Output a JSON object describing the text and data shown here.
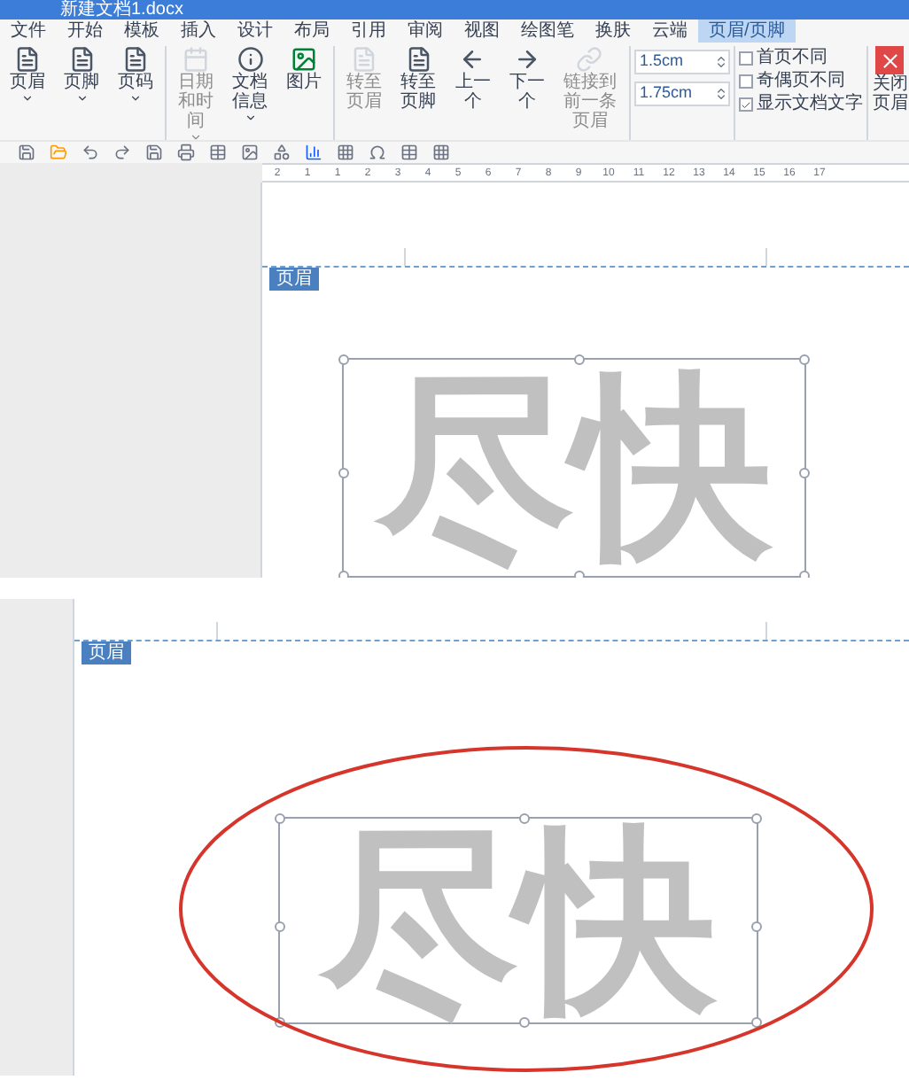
{
  "window": {
    "title": "新建文档1.docx"
  },
  "menu_tabs": [
    {
      "label": "文件",
      "selected": false
    },
    {
      "label": "开始",
      "selected": false
    },
    {
      "label": "模板",
      "selected": false
    },
    {
      "label": "插入",
      "selected": false
    },
    {
      "label": "设计",
      "selected": false
    },
    {
      "label": "布局",
      "selected": false
    },
    {
      "label": "引用",
      "selected": false
    },
    {
      "label": "审阅",
      "selected": false
    },
    {
      "label": "视图",
      "selected": false
    },
    {
      "label": "绘图笔",
      "selected": false
    },
    {
      "label": "换肤",
      "selected": false
    },
    {
      "label": "云端",
      "selected": false
    },
    {
      "label": "页眉/页脚",
      "selected": true
    }
  ],
  "ribbon": {
    "buttons": [
      {
        "label": "页眉",
        "kind": "page",
        "disabled": false,
        "menu": true
      },
      {
        "label": "页脚",
        "kind": "page",
        "disabled": false,
        "menu": true
      },
      {
        "label": "页码",
        "kind": "page",
        "disabled": false,
        "menu": true
      },
      {
        "label": "日期和时间",
        "kind": "calendar",
        "disabled": true,
        "menu": true
      },
      {
        "label": "文档信息",
        "kind": "info",
        "disabled": false,
        "menu": true
      },
      {
        "label": "图片",
        "kind": "image",
        "disabled": false,
        "menu": false
      },
      {
        "label": "转至页眉",
        "kind": "page",
        "disabled": true,
        "menu": false
      },
      {
        "label": "转至页脚",
        "kind": "page",
        "disabled": false,
        "menu": false
      },
      {
        "label": "上一个",
        "kind": "prev",
        "disabled": false,
        "menu": false
      },
      {
        "label": "下一个",
        "kind": "next",
        "disabled": false,
        "menu": false
      },
      {
        "label": "链接到前一条页眉",
        "kind": "link",
        "disabled": true,
        "menu": false
      }
    ],
    "spinners": [
      {
        "value": "1.5cm"
      },
      {
        "value": "1.75cm"
      }
    ],
    "checkboxes": [
      {
        "label": "首页不同",
        "checked": false
      },
      {
        "label": "奇偶页不同",
        "checked": false
      },
      {
        "label": "显示文档文字",
        "checked": true
      }
    ],
    "close_button": "关闭页眉"
  },
  "ruler": {
    "labels": [
      "2",
      "1",
      "1",
      "2",
      "3",
      "4",
      "5",
      "6",
      "7",
      "8",
      "9",
      "10",
      "11",
      "12",
      "13",
      "14",
      "15",
      "16",
      "17"
    ]
  },
  "views": [
    {
      "header_tag": "页眉",
      "text_box": "尽快",
      "circled": false
    },
    {
      "header_tag": "页眉",
      "text_box": "尽快",
      "circled": true
    }
  ]
}
